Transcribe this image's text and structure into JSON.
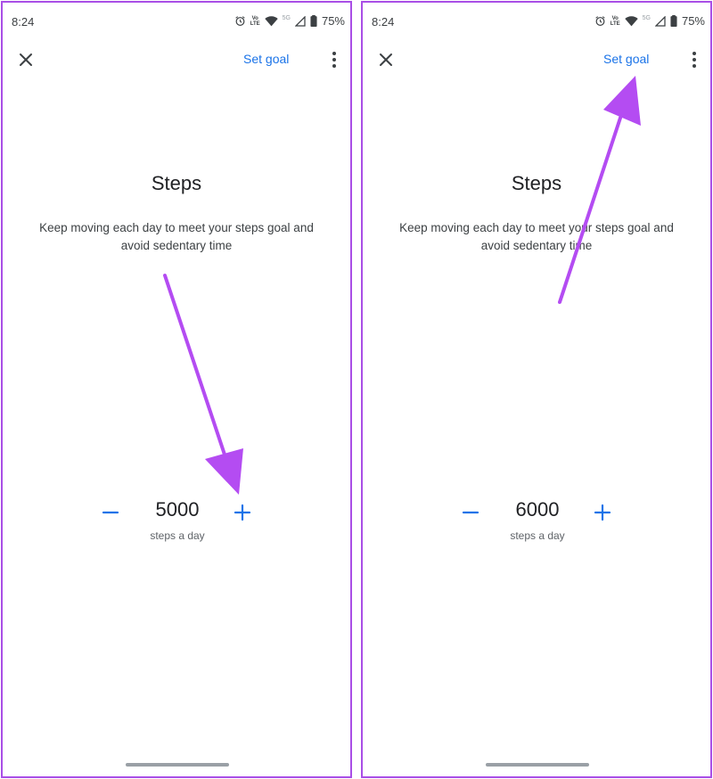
{
  "panels": [
    {
      "status": {
        "time": "8:24",
        "volte": "Vo\nLTE",
        "network": "5G",
        "battery": "75%"
      },
      "toolbar": {
        "action_label": "Set goal"
      },
      "title": "Steps",
      "description": "Keep moving each day to meet your steps goal and avoid sedentary time",
      "stepper": {
        "value": "5000",
        "unit": "steps a day"
      }
    },
    {
      "status": {
        "time": "8:24",
        "volte": "Vo\nLTE",
        "network": "5G",
        "battery": "75%"
      },
      "toolbar": {
        "action_label": "Set goal"
      },
      "title": "Steps",
      "description": "Keep moving each day to meet your steps goal and avoid sedentary time",
      "stepper": {
        "value": "6000",
        "unit": "steps a day"
      }
    }
  ],
  "colors": {
    "accent": "#1a73e8",
    "annotation_arrow": "#b44cf2",
    "panel_border": "#a94ee6"
  },
  "icons": [
    "close-icon",
    "more-vert-icon",
    "minus-icon",
    "plus-icon",
    "alarm-icon",
    "wifi-icon",
    "signal-icon",
    "battery-icon"
  ]
}
